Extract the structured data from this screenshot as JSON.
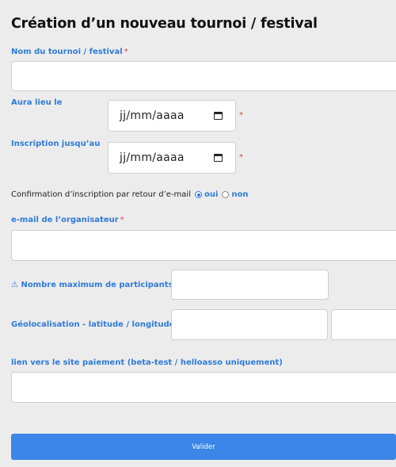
{
  "form": {
    "title": "Création d’un nouveau tournoi / festival",
    "name_label": "Nom du tournoi / festival",
    "required_mark": "*",
    "name_value": "",
    "date_label": "Aura lieu le",
    "date_value": "jj/mm/aaaa",
    "registration_label": "Inscription jusqu’au",
    "registration_value": "jj/mm/aaaa",
    "confirm_label": "Confirmation d’inscription par retour d’e-mail",
    "confirm_yes": "oui",
    "confirm_no": "non",
    "confirm_selected": "oui",
    "email_label": "e-mail de l’organisateur",
    "email_value": "",
    "max_participants_label": "⚠ Nombre maximum de participants",
    "max_participants_value": "",
    "geo_label": "Géolocalisation - latitude / longitude",
    "latitude_value": "",
    "longitude_value": "",
    "payment_label": "lien vers le site paiement (beta-test / helloasso uniquement)",
    "payment_value": "",
    "submit_label": "Valider"
  },
  "colors": {
    "accent": "#2f7bd9",
    "button": "#3b86e6",
    "required": "#e04040",
    "background": "#ececec"
  }
}
